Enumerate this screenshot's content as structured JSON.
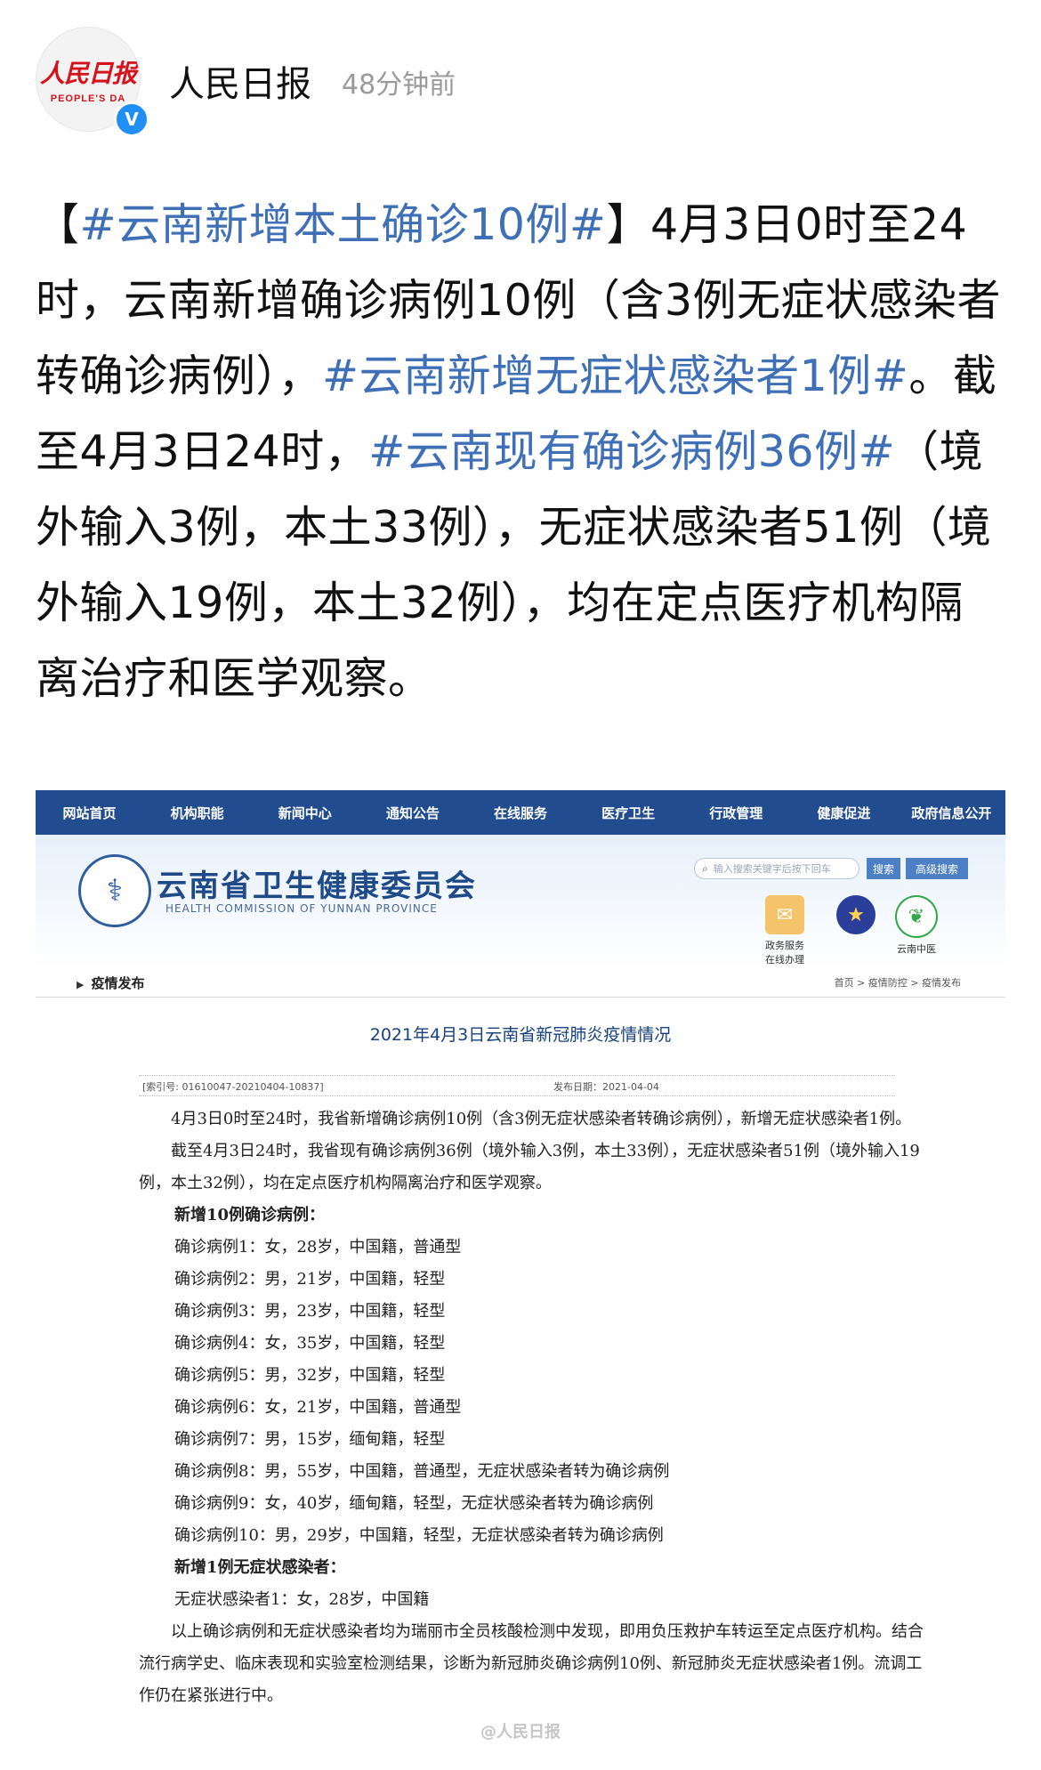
{
  "account": {
    "name": "人民日报",
    "time": "48分钟前",
    "logo_cn": "人民日报",
    "logo_en": "PEOPLE'S DA",
    "verified_icon": "V"
  },
  "post": {
    "p1_open": "【",
    "tag1": "#云南新增本土确诊10例#",
    "p1_close": "】4月3日0时至24时，云南新增确诊病例10例（含3例无症状感染者转确诊病例），",
    "tag2": "#云南新增无症状感染者1例#",
    "p2": "。截至4月3日24时，",
    "tag3": "#云南现有确诊病例36例#",
    "p3": "（境外输入3例，本土33例），无症状感染者51例（境外输入19例，本土32例），均在定点医疗机构隔离治疗和医学观察。"
  },
  "shot": {
    "nav": [
      "网站首页",
      "机构职能",
      "新闻中心",
      "通知公告",
      "在线服务",
      "医疗卫生",
      "行政管理",
      "健康促进",
      "政府信息公开"
    ],
    "org_cn": "云南省卫生健康委员会",
    "org_en": "HEALTH COMMISSION OF YUNNAN PROVINCE",
    "search_placeholder": "输入搜索关键字后按下回车",
    "search_btn": "搜索",
    "adv_btn": "高级搜索",
    "svc1_label_1": "政务服务",
    "svc1_label_2": "在线办理",
    "svc3_label": "云南中医",
    "section": "疫情发布",
    "crumb": "首页 > 疫情防控 > 疫情发布",
    "doc_title": "2021年4月3日云南省新冠肺炎疫情情况",
    "index_no": "[索引号: 01610047-20210404-10837]",
    "pub_date": "发布日期：2021-04-04",
    "para1": "4月3日0时至24时，我省新增确诊病例10例（含3例无症状感染者转确诊病例），新增无症状感染者1例。",
    "para2": "截至4月3日24时，我省现有确诊病例36例（境外输入3例，本土33例），无症状感染者51例（境外输入19例，本土32例），均在定点医疗机构隔离治疗和医学观察。",
    "head1": "新增10例确诊病例：",
    "cases": [
      "确诊病例1：女，28岁，中国籍，普通型",
      "确诊病例2：男，21岁，中国籍，轻型",
      "确诊病例3：男，23岁，中国籍，轻型",
      "确诊病例4：女，35岁，中国籍，轻型",
      "确诊病例5：男，32岁，中国籍，轻型",
      "确诊病例6：女，21岁，中国籍，普通型",
      "确诊病例7：男，15岁，缅甸籍，轻型",
      "确诊病例8：男，55岁，中国籍，普通型，无症状感染者转为确诊病例",
      "确诊病例9：女，40岁，缅甸籍，轻型，无症状感染者转为确诊病例",
      "确诊病例10：男，29岁，中国籍，轻型，无症状感染者转为确诊病例"
    ],
    "head2": "新增1例无症状感染者：",
    "asym": "无症状感染者1：女，28岁，中国籍",
    "para3": "以上确诊病例和无症状感染者均为瑞丽市全员核酸检测中发现，即用负压救护车转运至定点医疗机构。结合流行病学史、临床表现和实验室检测结果，诊断为新冠肺炎确诊病例10例、新冠肺炎无症状感染者1例。流调工作仍在紧张进行中。",
    "watermark": "@人民日报"
  }
}
